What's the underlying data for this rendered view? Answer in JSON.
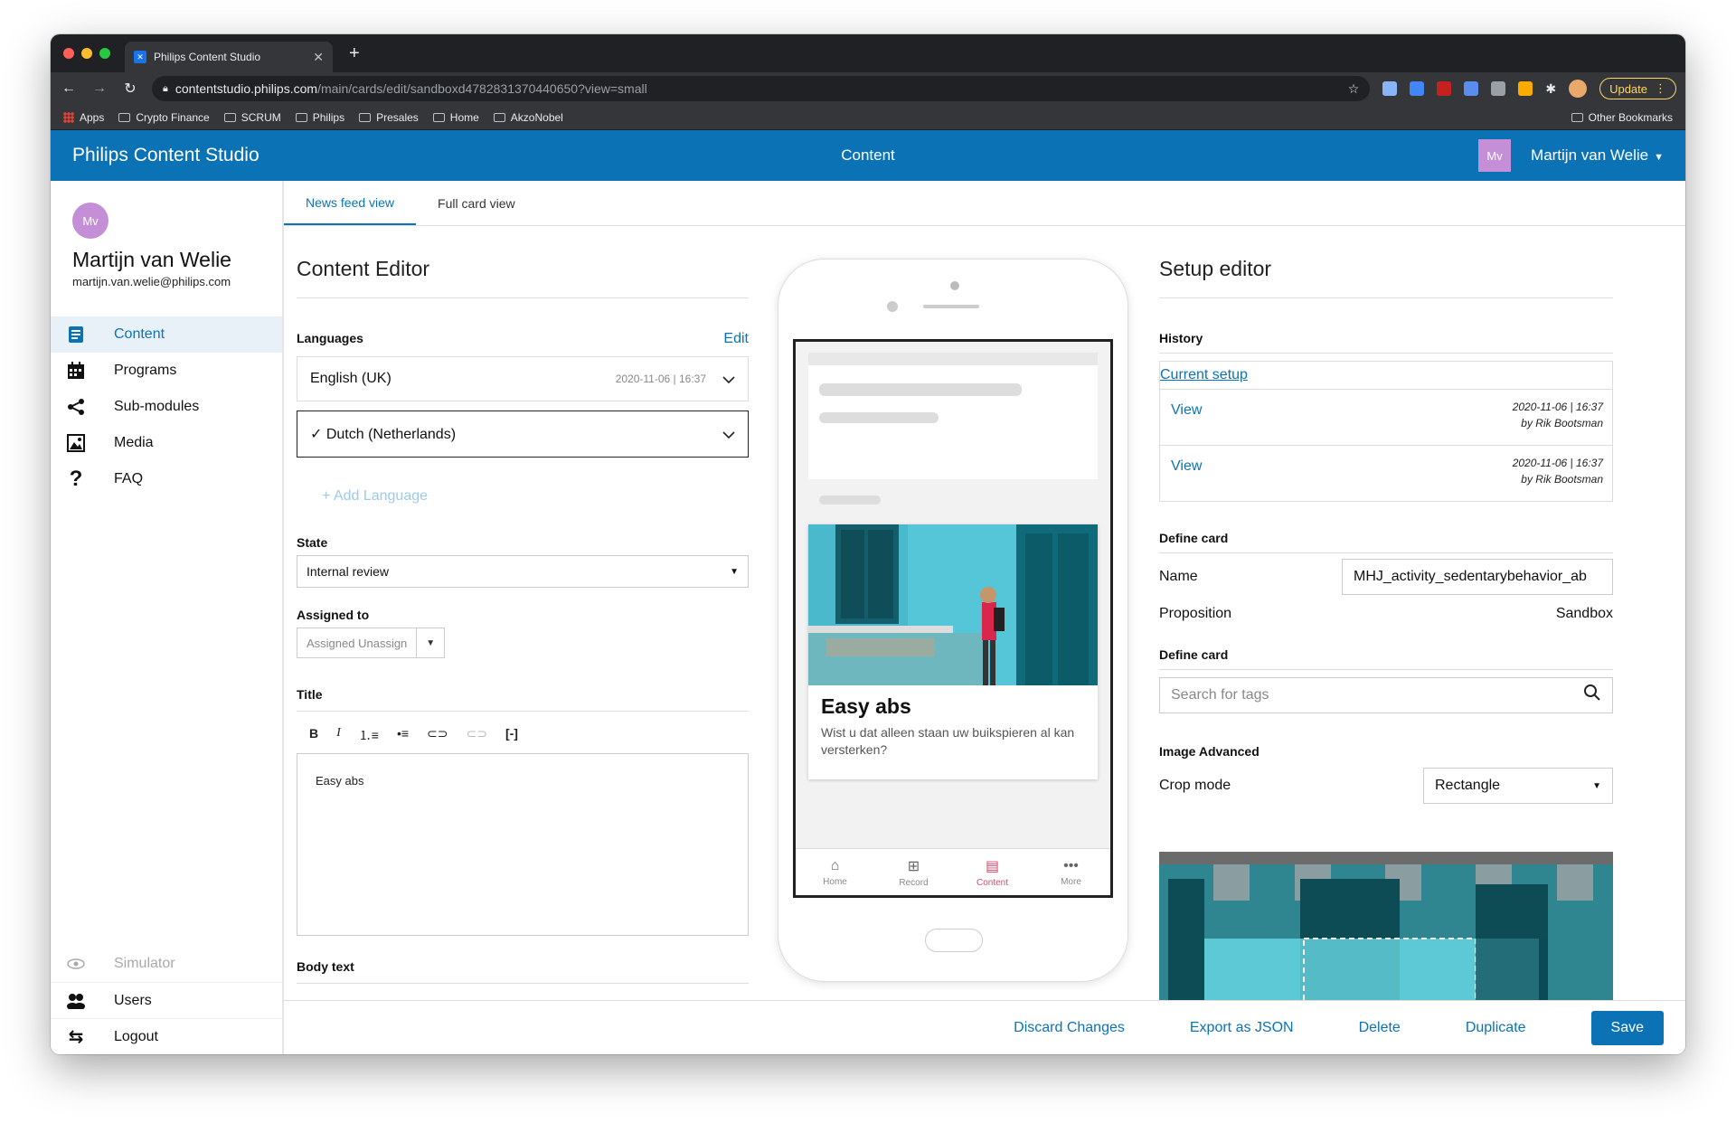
{
  "browser": {
    "tab_title": "Philips Content Studio",
    "url_host": "contentstudio.philips.com",
    "url_path": "/main/cards/edit/sandboxd4782831370440650?view=small",
    "update_label": "Update",
    "bookmarks": [
      "Apps",
      "Crypto Finance",
      "SCRUM",
      "Philips",
      "Presales",
      "Home",
      "AkzoNobel"
    ],
    "other_bookmarks": "Other Bookmarks"
  },
  "header": {
    "brand": "Philips Content Studio",
    "title": "Content",
    "user_initials": "Mv",
    "user_name": "Martijn van Welie"
  },
  "sidebar": {
    "initials": "Mv",
    "name": "Martijn van Welie",
    "email": "martijn.van.welie@philips.com",
    "items": [
      {
        "label": "Content",
        "icon": "document-icon"
      },
      {
        "label": "Programs",
        "icon": "calendar-icon"
      },
      {
        "label": "Sub-modules",
        "icon": "share-icon"
      },
      {
        "label": "Media",
        "icon": "image-icon"
      },
      {
        "label": "FAQ",
        "icon": "question-icon"
      }
    ],
    "bottom": [
      {
        "label": "Simulator",
        "icon": "eye-icon"
      },
      {
        "label": "Users",
        "icon": "users-icon"
      },
      {
        "label": "Logout",
        "icon": "logout-icon"
      }
    ]
  },
  "tabs": [
    "News feed view",
    "Full card view"
  ],
  "content_editor": {
    "heading": "Content Editor",
    "languages_label": "Languages",
    "edit_label": "Edit",
    "language_1": "English (UK)",
    "language_1_date": "2020-11-06 | 16:37",
    "language_2": "✓ Dutch (Netherlands)",
    "add_language": "+ Add Language",
    "state_label": "State",
    "state_value": "Internal review",
    "assigned_label": "Assigned to",
    "assigned_value": "Assigned Unassign",
    "title_label": "Title",
    "title_value": "Easy abs",
    "body_label": "Body text"
  },
  "preview": {
    "card_title": "Easy abs",
    "card_desc": "Wist u dat alleen staan uw buikspieren al kan versterken?",
    "nav": [
      {
        "label": "Home",
        "icon": "home-icon"
      },
      {
        "label": "Record",
        "icon": "record-icon"
      },
      {
        "label": "Content",
        "icon": "content-icon"
      },
      {
        "label": "More",
        "icon": "more-icon"
      }
    ]
  },
  "setup_editor": {
    "heading": "Setup editor",
    "history_label": "History",
    "current_setup": "Current setup",
    "history": [
      {
        "action": "View",
        "date": "2020-11-06 | 16:37",
        "by": "by Rik Bootsman"
      },
      {
        "action": "View",
        "date": "2020-11-06 | 16:37",
        "by": "by Rik Bootsman"
      }
    ],
    "define_card_label": "Define card",
    "name_label": "Name",
    "name_value": "MHJ_activity_sedentarybehavior_ab",
    "proposition_label": "Proposition",
    "proposition_value": "Sandbox",
    "define_card_label_2": "Define card",
    "search_placeholder": "Search for tags",
    "image_advanced_label": "Image Advanced",
    "crop_mode_label": "Crop mode",
    "crop_mode_value": "Rectangle"
  },
  "actions": {
    "discard": "Discard Changes",
    "export": "Export as JSON",
    "delete": "Delete",
    "duplicate": "Duplicate",
    "save": "Save"
  },
  "colors": {
    "brand_blue": "#0b73b5",
    "avatar_purple": "#c48fd6",
    "accent_pink": "#e0456c"
  }
}
